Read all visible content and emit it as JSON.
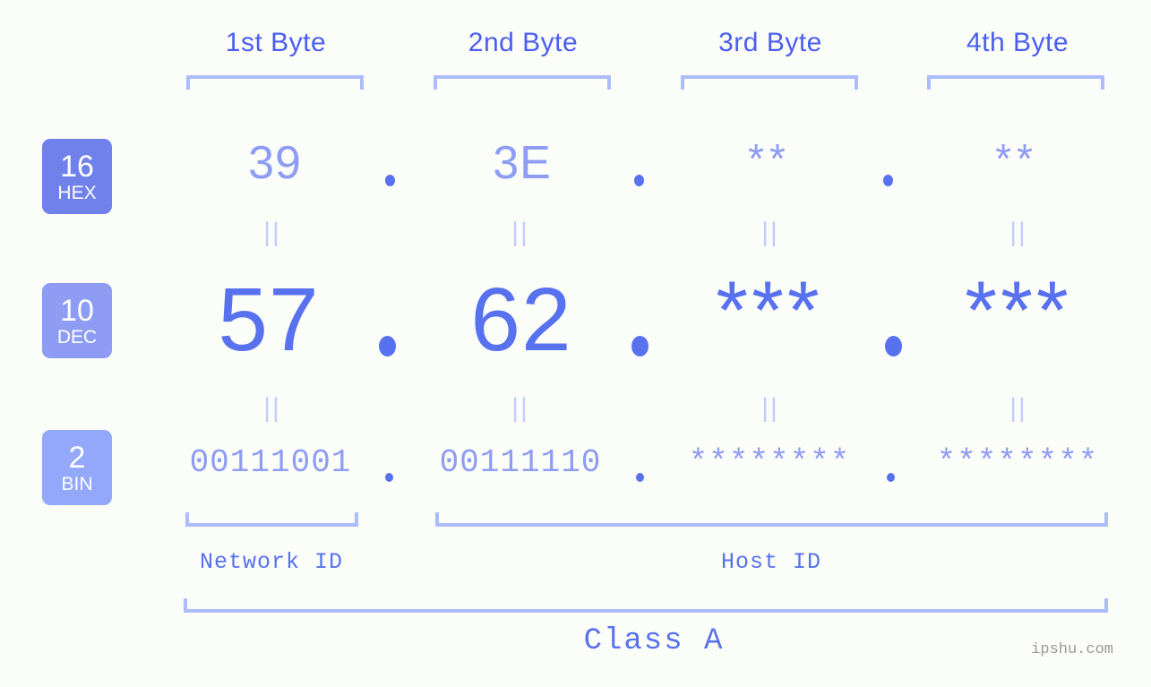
{
  "meta": {
    "watermark": "ipshu.com"
  },
  "byte_headers": [
    {
      "label": "1st Byte"
    },
    {
      "label": "2nd Byte"
    },
    {
      "label": "3rd Byte"
    },
    {
      "label": "4th Byte"
    }
  ],
  "radix_badges": [
    {
      "number": "16",
      "name": "HEX",
      "color": "#7181ec"
    },
    {
      "number": "10",
      "name": "DEC",
      "color": "#8e9cf4"
    },
    {
      "number": "2",
      "name": "BIN",
      "color": "#93a7fb"
    }
  ],
  "rows": {
    "hex": {
      "radix": "16",
      "radix_name": "HEX",
      "values": [
        "39",
        "3E",
        "**",
        "**"
      ],
      "separators": [
        ".",
        ".",
        "."
      ]
    },
    "dec": {
      "radix": "10",
      "radix_name": "DEC",
      "values": [
        "57",
        "62",
        "***",
        "***"
      ],
      "separators": [
        ".",
        ".",
        "."
      ]
    },
    "bin": {
      "radix": "2",
      "radix_name": "BIN",
      "values": [
        "00111001",
        "00111110",
        "********",
        "********"
      ],
      "separators": [
        ".",
        ".",
        "."
      ]
    }
  },
  "equality_marks": {
    "upper": [
      "||",
      "||",
      "||",
      "||"
    ],
    "lower": [
      "||",
      "||",
      "||",
      "||"
    ]
  },
  "segments": {
    "network_id": "Network ID",
    "host_id": "Host ID",
    "class": "Class A"
  },
  "colors": {
    "background": "#fbfdf8",
    "accent_dark": "#4a5ef0",
    "accent_mid": "#5871ef",
    "accent_light": "#8e9cf4",
    "bracket": "#adbcfb",
    "equality": "#c3cdfc",
    "watermark": "#9a9a9a"
  }
}
